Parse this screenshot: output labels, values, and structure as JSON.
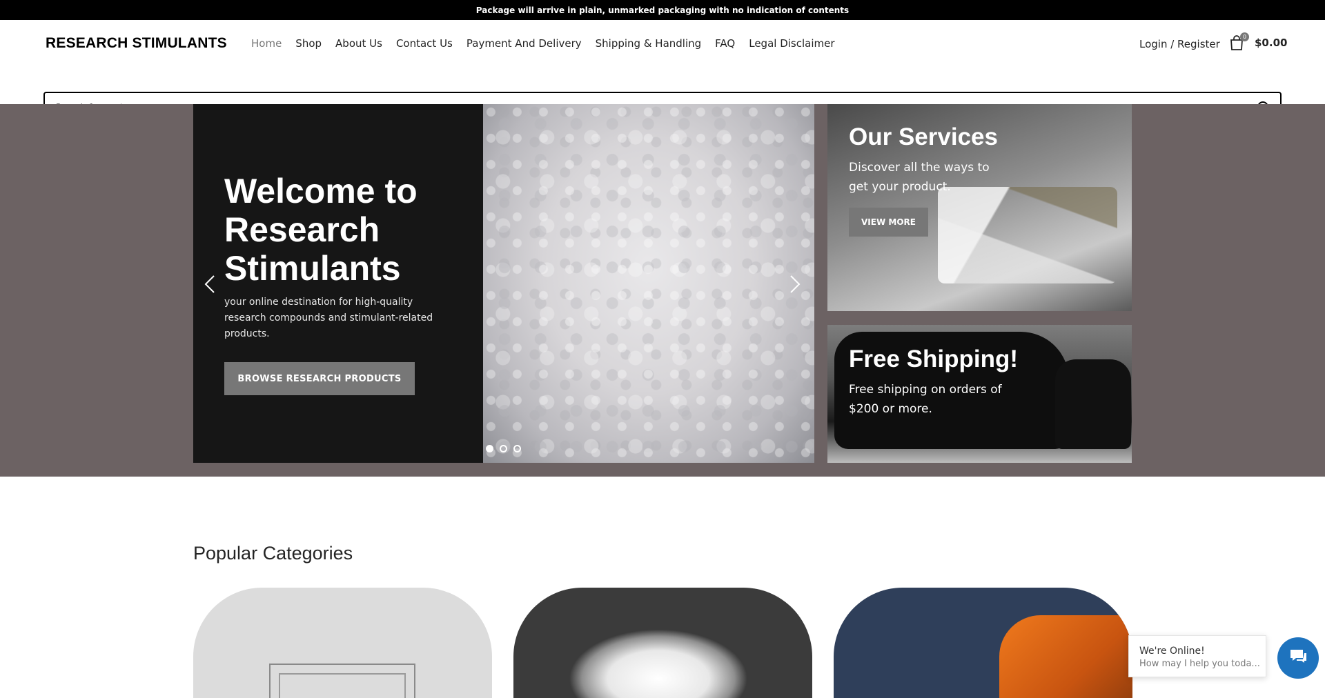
{
  "topbar": {
    "text": "Package will arrive in plain, unmarked packaging with no indication of contents"
  },
  "header": {
    "logo": "RESEARCH STIMULANTS",
    "nav": [
      "Home",
      "Shop",
      "About Us",
      "Contact Us",
      "Payment And Delivery",
      "Shipping & Handling",
      "FAQ",
      "Legal Disclaimer"
    ],
    "account": "Login / Register",
    "cart": {
      "count": "0",
      "total": "$0.00"
    }
  },
  "search": {
    "placeholder": "Search for posts"
  },
  "slider": {
    "title": "Welcome to Research Stimulants",
    "text": "your online destination for high-quality research compounds and stimulant-related products.",
    "button": "BROWSE RESEARCH PRODUCTS",
    "active_slide": 1,
    "slide_count": 3
  },
  "promos": {
    "services": {
      "title": "Our Services",
      "text": "Discover all the ways to get your product.",
      "button": "VIEW MORE"
    },
    "shipping": {
      "title": "Free Shipping!",
      "text": "Free shipping on orders of $200 or more."
    }
  },
  "categories": {
    "title": "Popular Categories"
  },
  "chat": {
    "status": "We're Online!",
    "prompt": "How may I help you toda..."
  },
  "colors": {
    "topbar": "#000000",
    "hero_bg": "#6c6263",
    "button": "#777777",
    "chat": "#1e73be"
  }
}
